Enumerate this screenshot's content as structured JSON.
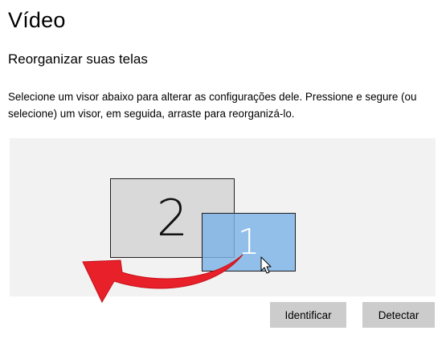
{
  "page": {
    "title": "Vídeo",
    "subtitle": "Reorganizar suas telas",
    "description": "Selecione um visor abaixo para alterar as configurações dele. Pressione e segure (ou selecione) um visor, em seguida, arraste para reorganizá-lo."
  },
  "monitors": [
    {
      "number": "2",
      "selected": false
    },
    {
      "number": "1",
      "selected": true
    }
  ],
  "buttons": {
    "identify_label": "Identificar",
    "detect_label": "Detectar"
  },
  "icons": {
    "cursor": "mouse-pointer-icon",
    "arrow": "curved-arrow-icon"
  },
  "colors": {
    "arrow": "#e8202a",
    "selected_monitor": "#7bb3e6",
    "monitor_inactive": "#d9d9d9",
    "button_bg": "#cccccc",
    "area_bg": "#f2f2f2"
  }
}
